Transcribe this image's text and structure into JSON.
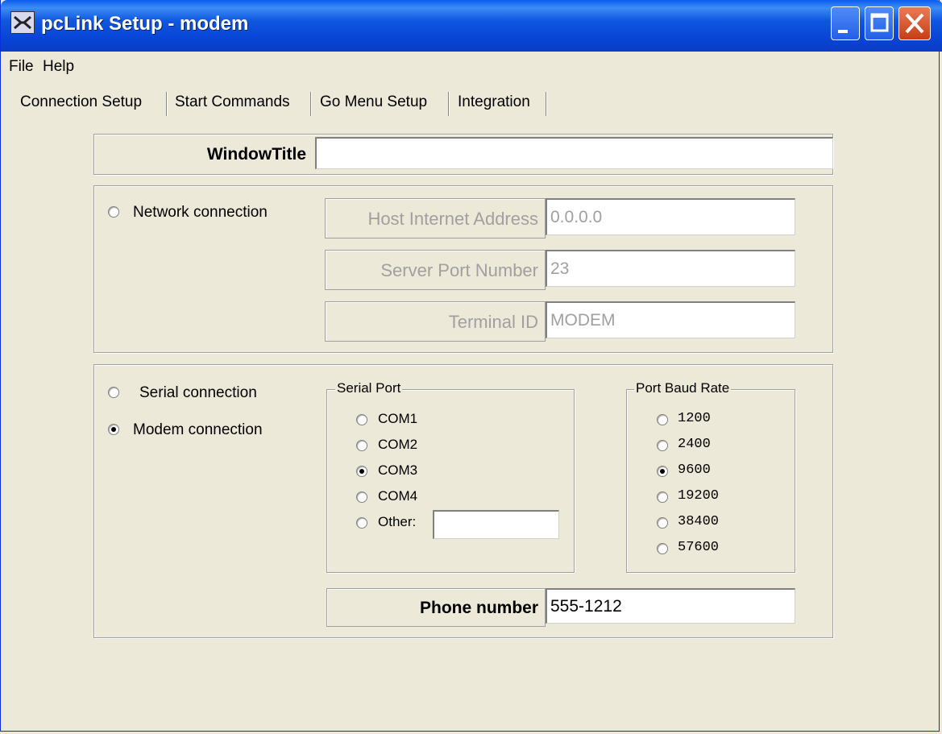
{
  "window": {
    "title": "pcLink Setup - modem"
  },
  "menu": [
    "File",
    "Help"
  ],
  "tabs": [
    "Connection Setup",
    "Start Commands",
    "Go Menu Setup",
    "Integration"
  ],
  "window_title_field": {
    "label": "WindowTitle",
    "value": ""
  },
  "network": {
    "option_label": "Network connection",
    "selected": false,
    "host_address": {
      "label": "Host Internet Address",
      "value": "0.0.0.0"
    },
    "server_port": {
      "label": "Server Port Number",
      "value": "23"
    },
    "terminal_id": {
      "label": "Terminal ID",
      "value": "MODEM"
    }
  },
  "connection_type": {
    "serial_label": "Serial connection",
    "modem_label": "Modem connection",
    "selected": "Modem connection"
  },
  "serial_port": {
    "title": "Serial Port",
    "options": [
      "COM1",
      "COM2",
      "COM3",
      "COM4",
      "Other:"
    ],
    "selected": "COM3",
    "other_value": ""
  },
  "baud_rate": {
    "title": "Port Baud Rate",
    "options": [
      "1200",
      "2400",
      "9600",
      "19200",
      "38400",
      "57600"
    ],
    "selected": "9600"
  },
  "phone": {
    "label": "Phone number",
    "value": "555-1212"
  },
  "colors": {
    "titlebar": "#0a4fdc",
    "face": "#ece9d8",
    "disabled_text": "#a0a0a0"
  }
}
